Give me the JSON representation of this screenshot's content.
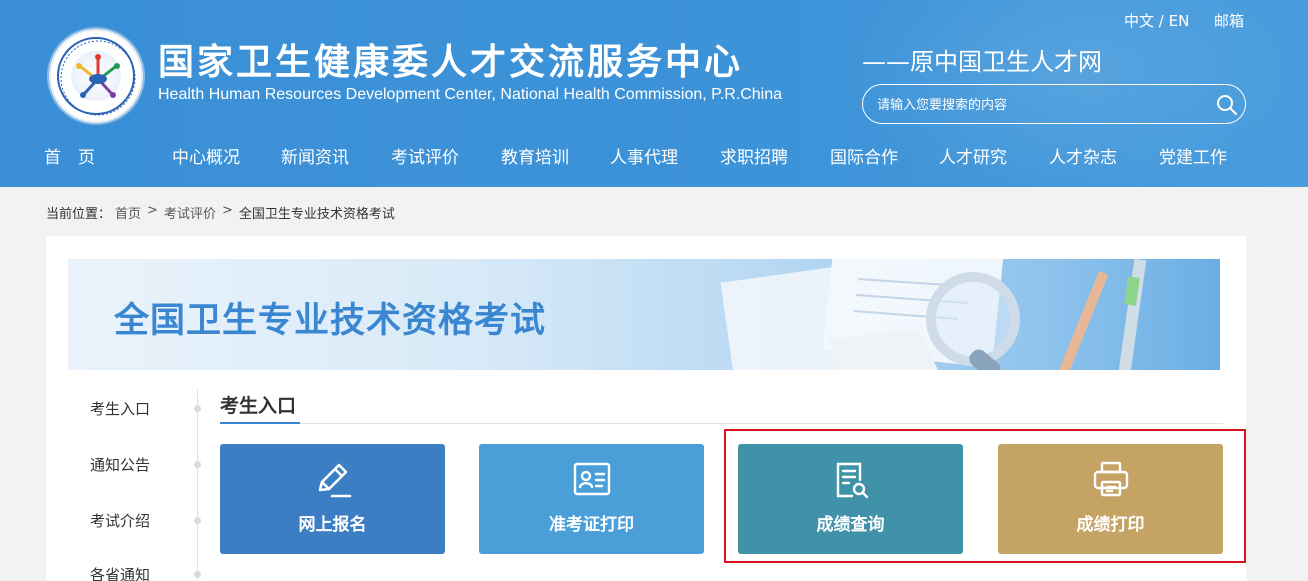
{
  "header": {
    "title_cn": "国家卫生健康委人才交流服务中心",
    "title_en": "Health Human Resources Development Center, National Health Commission, P.R.China",
    "subtitle": "——原中国卫生人才网",
    "lang": "中文 / EN",
    "mail": "邮箱",
    "search_placeholder": "请输入您要搜索的内容",
    "logo_icon": "logo-emblem"
  },
  "nav": [
    {
      "label": "首　页"
    },
    {
      "label": "中心概况"
    },
    {
      "label": "新闻资讯"
    },
    {
      "label": "考试评价"
    },
    {
      "label": "教育培训"
    },
    {
      "label": "人事代理"
    },
    {
      "label": "求职招聘"
    },
    {
      "label": "国际合作"
    },
    {
      "label": "人才研究"
    },
    {
      "label": "人才杂志"
    },
    {
      "label": "党建工作"
    }
  ],
  "breadcrumb": {
    "prefix": "当前位置：",
    "items": [
      "首页",
      "考试评价",
      "全国卫生专业技术资格考试"
    ],
    "separator": ">"
  },
  "banner": {
    "title": "全国卫生专业技术资格考试"
  },
  "sidebar": {
    "items": [
      {
        "label": "考生入口"
      },
      {
        "label": "通知公告"
      },
      {
        "label": "考试介绍"
      },
      {
        "label": "各省通知"
      }
    ]
  },
  "section": {
    "title": "考生入口"
  },
  "tiles": [
    {
      "label": "网上报名",
      "icon": "pencil-edit-icon",
      "color": "#3c7ec4"
    },
    {
      "label": "准考证打印",
      "icon": "id-card-icon",
      "color": "#4b9fd9"
    },
    {
      "label": "成绩查询",
      "icon": "document-search-icon",
      "color": "#3f92a8"
    },
    {
      "label": "成绩打印",
      "icon": "printer-icon",
      "color": "#c5a365"
    }
  ],
  "colors": {
    "header_bg": "#3a8fd6",
    "accent": "#3a86d0",
    "highlight_border": "#d9141e"
  }
}
